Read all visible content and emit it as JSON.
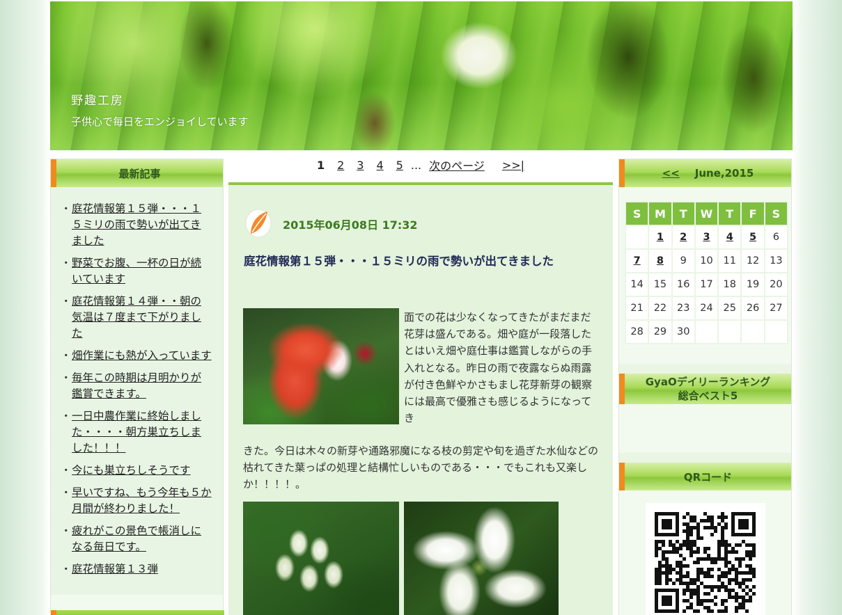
{
  "header": {
    "site_title": "野趣工房",
    "tagline": "子供心で毎日をエンジョイしています"
  },
  "recent": {
    "heading": "最新記事",
    "items": [
      "庭花情報第１５弾・・・１５ミリの雨で勢いが出てきました",
      "野菜でお腹、一杯の日が続いています",
      "庭花情報第１４弾・・朝の気温は７度まで下がりました",
      "畑作業にも熱が入っています",
      "毎年この時期は月明かりが鑑賞できます。",
      "一日中農作業に終始しました・・・・朝方巣立ちしました！！！",
      "今にも巣立ちしそうです",
      "早いですね、もう今年も５か月間が終わりました！",
      "疲れがこの景色で帳消しになる毎日です。",
      "庭花情報第１３弾"
    ]
  },
  "pager": {
    "current": "1",
    "pages": [
      "2",
      "3",
      "4",
      "5"
    ],
    "ellipsis": "...",
    "next": "次のページ",
    "last": ">>|"
  },
  "post": {
    "date": "2015年06月08日 17:32",
    "title": "庭花情報第１５弾・・・１５ミリの雨で勢いが出てきました",
    "body_right": "面での花は少なくなってきたがまだまだ花芽は盛んである。畑や庭が一段落したとはいえ畑や庭仕事は鑑賞しながらの手入れとなる。昨日の雨で夜露ならぬ雨露が付き色鮮やかさもまし花芽新芽の観察には最高で優雅さも感じるようになってき",
    "body_full": "きた。今日は木々の新芽や通路邪魔になる枝の剪定や旬を過ぎた水仙などの枯れてきた葉っぱの処理と結構忙しいものである・・・でもこれも又楽しか！！！！。"
  },
  "calendar": {
    "prev": "<<",
    "month": "June,2015",
    "weekdays": [
      "S",
      "M",
      "T",
      "W",
      "T",
      "F",
      "S"
    ],
    "weeks": [
      [
        "",
        "1",
        "2",
        "3",
        "4",
        "5",
        "6"
      ],
      [
        "7",
        "8",
        "9",
        "10",
        "11",
        "12",
        "13"
      ],
      [
        "14",
        "15",
        "16",
        "17",
        "18",
        "19",
        "20"
      ],
      [
        "21",
        "22",
        "23",
        "24",
        "25",
        "26",
        "27"
      ],
      [
        "28",
        "29",
        "30",
        "",
        "",
        "",
        ""
      ]
    ],
    "linked_days": [
      "1",
      "2",
      "3",
      "4",
      "5",
      "7",
      "8"
    ]
  },
  "gyao": {
    "line1": "GyaOデイリーランキング",
    "line2": "総合ベスト5"
  },
  "qr": {
    "heading": "QRコード"
  },
  "colors": {
    "accent_green": "#8dc63f",
    "orange_tab": "#f08a1e",
    "date_green": "#3c7a1e"
  }
}
